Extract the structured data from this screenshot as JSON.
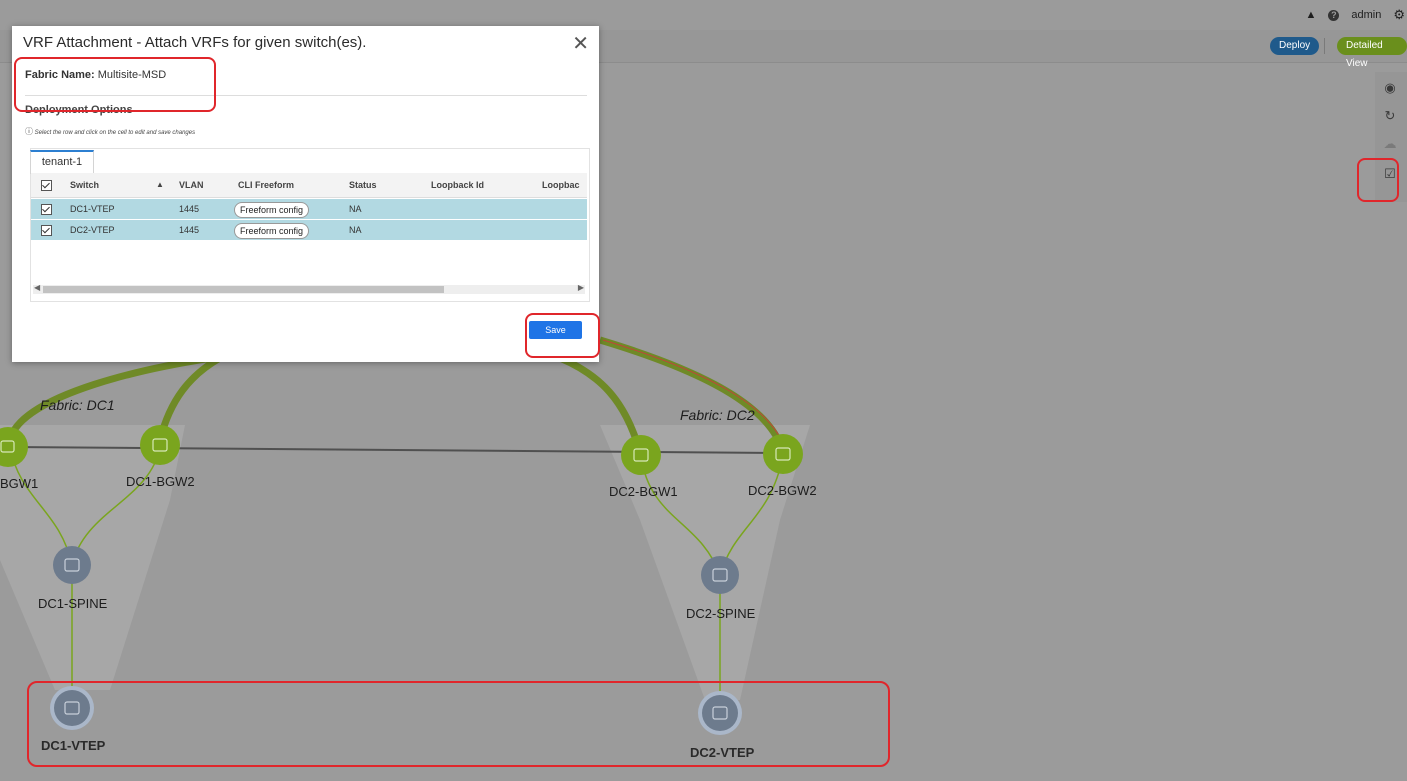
{
  "header": {
    "user": "admin",
    "deploy_label": "Deploy",
    "detailed_view_label": "Detailed View",
    "bell_icon": "bell-icon",
    "help_icon": "help-icon",
    "gear_icon": "gear-icon"
  },
  "right_tools": [
    "eye-icon",
    "refresh-icon",
    "cloud-icon",
    "checkbox-icon"
  ],
  "topology": {
    "fabrics": [
      {
        "name": "Fabric: DC1",
        "nodes": [
          "BGW1",
          "DC1-BGW2",
          "DC1-SPINE",
          "DC1-VTEP"
        ]
      },
      {
        "name": "Fabric: DC2",
        "nodes": [
          "DC2-BGW1",
          "DC2-BGW2",
          "DC2-SPINE",
          "DC2-VTEP"
        ]
      }
    ]
  },
  "modal": {
    "title": "VRF Attachment - Attach VRFs for given switch(es).",
    "fabric_name_label": "Fabric Name:",
    "fabric_name_value": "Multisite-MSD",
    "deployment_options": "Deployment Options",
    "hint": "Select the row and click on the cell to edit and save changes",
    "tab": "tenant-1",
    "columns": [
      "Switch",
      "VLAN",
      "CLI Freeform",
      "Status",
      "Loopback Id",
      "Loopbac"
    ],
    "rows": [
      {
        "switch": "DC1-VTEP",
        "vlan": "1445",
        "freeform": "Freeform config",
        "status": "NA",
        "checked": true
      },
      {
        "switch": "DC2-VTEP",
        "vlan": "1445",
        "freeform": "Freeform config",
        "status": "NA",
        "checked": true
      }
    ],
    "save_label": "Save"
  },
  "colors": {
    "accent_blue": "#1f74e6",
    "row_selected": "#b2d9e2",
    "node_green": "#7aa51e",
    "node_gray": "#6d7b8d",
    "highlight_red": "#e0262b"
  }
}
